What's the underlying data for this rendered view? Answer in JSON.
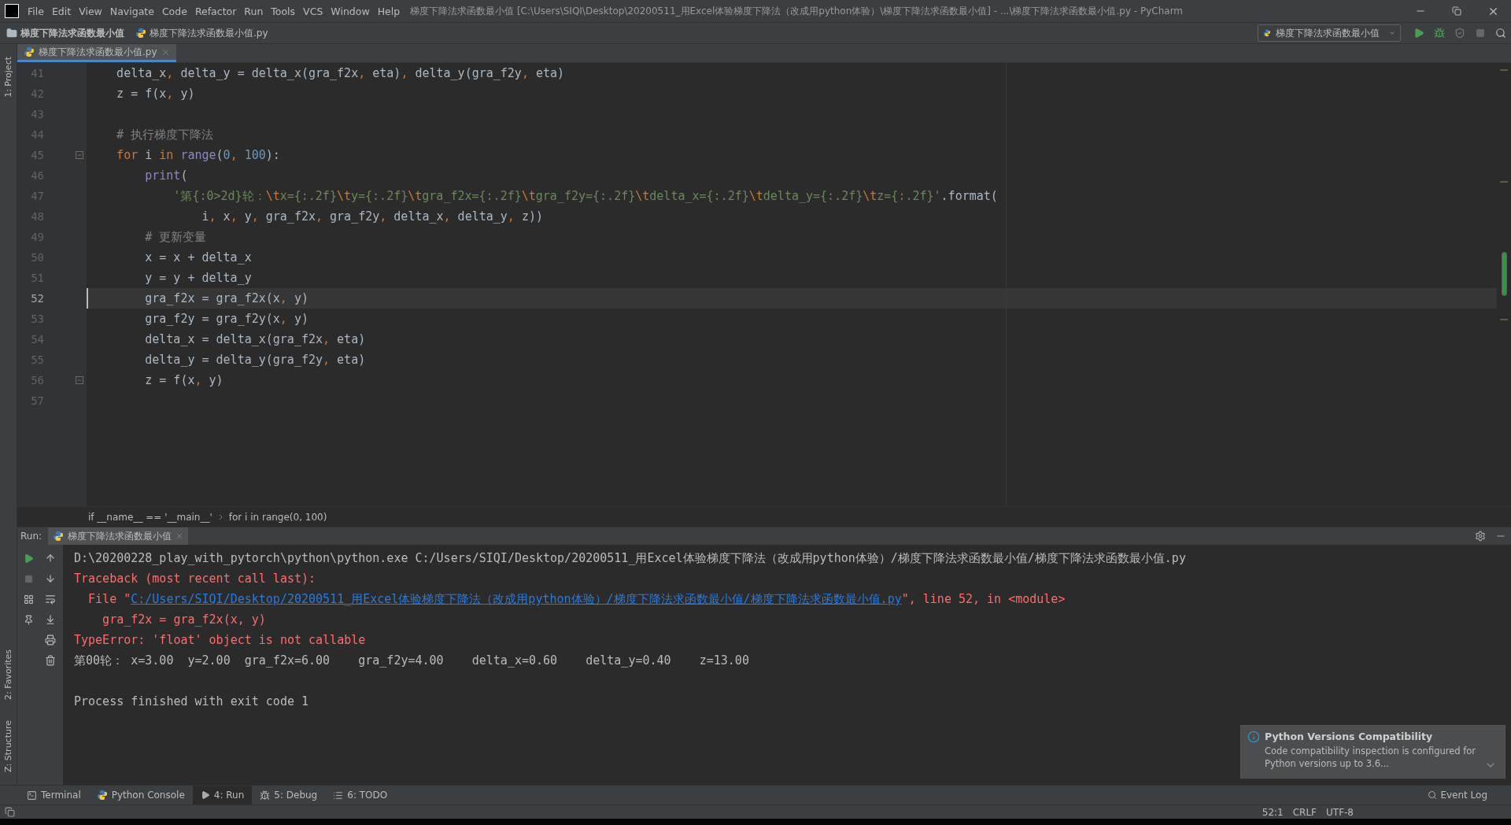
{
  "title_bar": {
    "menu": [
      "File",
      "Edit",
      "View",
      "Navigate",
      "Code",
      "Refactor",
      "Run",
      "Tools",
      "VCS",
      "Window",
      "Help"
    ],
    "title": "梯度下降法求函数最小值 [C:\\Users\\SIQI\\Desktop\\20200511_用Excel体验梯度下降法（改成用python体验）\\梯度下降法求函数最小值] - ...\\梯度下降法求函数最小值.py - PyCharm"
  },
  "nav_bar": {
    "breadcrumb": [
      {
        "kind": "folder",
        "label": "梯度下降法求函数最小值"
      },
      {
        "kind": "python_file",
        "label": "梯度下降法求函数最小值.py"
      }
    ],
    "run_config": "梯度下降法求函数最小值"
  },
  "left_tabs_top": [
    "1: Project"
  ],
  "left_tabs_bottom": [
    "2: Favorites",
    "Z: Structure"
  ],
  "editor_tabs": [
    {
      "label": "梯度下降法求函数最小值.py",
      "selected": true
    }
  ],
  "editor": {
    "lines": [
      {
        "number": "41",
        "current": false,
        "fold": false,
        "tokens": [
          {
            "kind": "plain",
            "text": "    delta_x"
          },
          {
            "kind": "punct",
            "text": ","
          },
          {
            "kind": "plain",
            "text": " delta_y = delta_x(gra_f2x"
          },
          {
            "kind": "punct",
            "text": ","
          },
          {
            "kind": "plain",
            "text": " eta)"
          },
          {
            "kind": "punct",
            "text": ","
          },
          {
            "kind": "plain",
            "text": " delta_y(gra_f2y"
          },
          {
            "kind": "punct",
            "text": ","
          },
          {
            "kind": "plain",
            "text": " eta)"
          }
        ]
      },
      {
        "number": "42",
        "current": false,
        "fold": false,
        "tokens": [
          {
            "kind": "plain",
            "text": "    z = f(x"
          },
          {
            "kind": "punct",
            "text": ","
          },
          {
            "kind": "plain",
            "text": " y)"
          }
        ]
      },
      {
        "number": "43",
        "current": false,
        "fold": false
      },
      {
        "number": "44",
        "current": false,
        "fold": false,
        "tokens": [
          {
            "kind": "comment",
            "text": "    # 执行梯度下降法"
          }
        ]
      },
      {
        "number": "45",
        "current": false,
        "fold": true,
        "tokens": [
          {
            "kind": "keyword",
            "text": "    for"
          },
          {
            "kind": "plain",
            "text": " i "
          },
          {
            "kind": "keyword",
            "text": "in"
          },
          {
            "kind": "builtin",
            "text": " range"
          },
          {
            "kind": "plain",
            "text": "("
          },
          {
            "kind": "number",
            "text": "0"
          },
          {
            "kind": "punct",
            "text": ","
          },
          {
            "kind": "number",
            "text": " 100"
          },
          {
            "kind": "plain",
            "text": "):"
          }
        ]
      },
      {
        "number": "46",
        "current": false,
        "fold": false,
        "tokens": [
          {
            "kind": "builtin",
            "text": "        print"
          },
          {
            "kind": "plain",
            "text": "("
          }
        ]
      },
      {
        "number": "47",
        "current": false,
        "fold": false,
        "tokens": [
          {
            "kind": "string",
            "text": "            '第{:0>2d}轮："
          },
          {
            "kind": "escape",
            "text": "\\t"
          },
          {
            "kind": "string",
            "text": "x={:.2f}"
          },
          {
            "kind": "escape",
            "text": "\\t"
          },
          {
            "kind": "string",
            "text": "y={:.2f}"
          },
          {
            "kind": "escape",
            "text": "\\t"
          },
          {
            "kind": "string",
            "text": "gra_f2x={:.2f}"
          },
          {
            "kind": "escape",
            "text": "\\t"
          },
          {
            "kind": "string",
            "text": "gra_f2y={:.2f}"
          },
          {
            "kind": "escape",
            "text": "\\t"
          },
          {
            "kind": "string",
            "text": "delta_x={:.2f}"
          },
          {
            "kind": "escape",
            "text": "\\t"
          },
          {
            "kind": "string",
            "text": "delta_y={:.2f}"
          },
          {
            "kind": "escape",
            "text": "\\t"
          },
          {
            "kind": "string",
            "text": "z={:.2f}'"
          },
          {
            "kind": "plain",
            "text": ".format("
          }
        ]
      },
      {
        "number": "48",
        "current": false,
        "fold": false,
        "tokens": [
          {
            "kind": "plain",
            "text": "                i"
          },
          {
            "kind": "punct",
            "text": ","
          },
          {
            "kind": "plain",
            "text": " x"
          },
          {
            "kind": "punct",
            "text": ","
          },
          {
            "kind": "plain",
            "text": " y"
          },
          {
            "kind": "punct",
            "text": ","
          },
          {
            "kind": "plain",
            "text": " gra_f2x"
          },
          {
            "kind": "punct",
            "text": ","
          },
          {
            "kind": "plain",
            "text": " gra_f2y"
          },
          {
            "kind": "punct",
            "text": ","
          },
          {
            "kind": "plain",
            "text": " delta_x"
          },
          {
            "kind": "punct",
            "text": ","
          },
          {
            "kind": "plain",
            "text": " delta_y"
          },
          {
            "kind": "punct",
            "text": ","
          },
          {
            "kind": "plain",
            "text": " z))"
          }
        ]
      },
      {
        "number": "49",
        "current": false,
        "fold": false,
        "tokens": [
          {
            "kind": "comment",
            "text": "        # 更新变量"
          }
        ]
      },
      {
        "number": "50",
        "current": false,
        "fold": false,
        "tokens": [
          {
            "kind": "plain",
            "text": "        x = x + delta_x"
          }
        ]
      },
      {
        "number": "51",
        "current": false,
        "fold": false,
        "tokens": [
          {
            "kind": "plain",
            "text": "        y = y + delta_y"
          }
        ]
      },
      {
        "number": "52",
        "current": true,
        "fold": false,
        "tokens": [
          {
            "kind": "plain",
            "text": "        gra_f2x = gra_f2x(x"
          },
          {
            "kind": "punct",
            "text": ","
          },
          {
            "kind": "plain",
            "text": " y)"
          }
        ]
      },
      {
        "number": "53",
        "current": false,
        "fold": false,
        "tokens": [
          {
            "kind": "plain",
            "text": "        gra_f2y = gra_f2y(x"
          },
          {
            "kind": "punct",
            "text": ","
          },
          {
            "kind": "plain",
            "text": " y)"
          }
        ]
      },
      {
        "number": "54",
        "current": false,
        "fold": false,
        "tokens": [
          {
            "kind": "plain",
            "text": "        delta_x = delta_x(gra_f2x"
          },
          {
            "kind": "punct",
            "text": ","
          },
          {
            "kind": "plain",
            "text": " eta)"
          }
        ]
      },
      {
        "number": "55",
        "current": false,
        "fold": false,
        "tokens": [
          {
            "kind": "plain",
            "text": "        delta_y = delta_y(gra_f2y"
          },
          {
            "kind": "punct",
            "text": ","
          },
          {
            "kind": "plain",
            "text": " eta)"
          }
        ]
      },
      {
        "number": "56",
        "current": false,
        "fold": true,
        "tokens": [
          {
            "kind": "plain",
            "text": "        z = f(x"
          },
          {
            "kind": "punct",
            "text": ","
          },
          {
            "kind": "plain",
            "text": " y)"
          }
        ]
      },
      {
        "number": "57",
        "current": false,
        "fold": false
      }
    ]
  },
  "breadcrumb": [
    "if __name__ == '__main__'",
    "for i in range(0, 100)"
  ],
  "run_panel": {
    "label": "Run:",
    "tabs": [
      {
        "label": "梯度下降法求函数最小值",
        "selected": true
      }
    ],
    "output": [
      {
        "kind": "command",
        "text": "D:\\20200228_play_with_pytorch\\python\\python.exe C:/Users/SIQI/Desktop/20200511_用Excel体验梯度下降法（改成用python体验）/梯度下降法求函数最小值/梯度下降法求函数最小值.py"
      },
      {
        "kind": "error",
        "text": "Traceback (most recent call last):"
      },
      {
        "kind": "link",
        "prefix": "  File \"",
        "link": "C:/Users/SIQI/Desktop/20200511_用Excel体验梯度下降法（改成用python体验）/梯度下降法求函数最小值/梯度下降法求函数最小值.py",
        "suffix": "\", line 52, in <module>"
      },
      {
        "kind": "error",
        "text": "    gra_f2x = gra_f2x(x, y)"
      },
      {
        "kind": "error",
        "text": "TypeError: 'float' object is not callable"
      },
      {
        "kind": "output",
        "text": "第00轮：\tx=3.00\ty=2.00\tgra_f2x=6.00\tgra_f2y=4.00\tdelta_x=0.60\tdelta_y=0.40\tz=13.00"
      },
      {
        "kind": "blank"
      },
      {
        "kind": "output",
        "text": "Process finished with exit code 1"
      }
    ]
  },
  "tool_windows": [
    {
      "kind": "terminal",
      "label": "Terminal",
      "selected": false
    },
    {
      "kind": "console",
      "label": "Python Console",
      "selected": false
    },
    {
      "kind": "run",
      "label": "4: Run",
      "selected": true
    },
    {
      "kind": "debug",
      "label": "5: Debug",
      "selected": false
    },
    {
      "kind": "todo",
      "label": "6: TODO",
      "selected": false
    }
  ],
  "event_log": "Event Log",
  "notification": {
    "title": "Python Versions Compatibility",
    "body": "Code compatibility inspection is configured for Python versions up to 3.6..."
  },
  "status_bar": {
    "items": [
      "52:1",
      "CRLF",
      "UTF-8"
    ]
  }
}
